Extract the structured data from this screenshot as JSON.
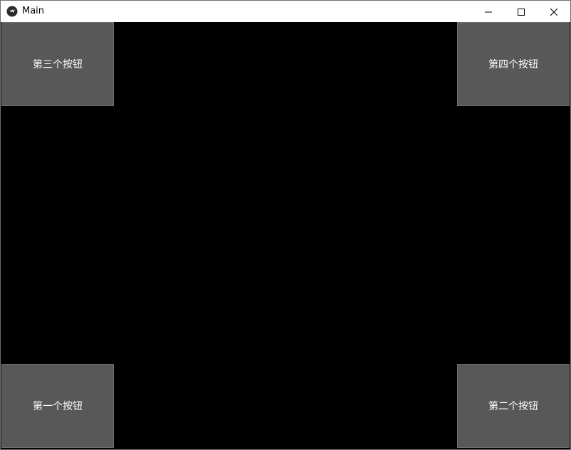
{
  "window": {
    "title": "Main",
    "icon": "kivy-logo-icon"
  },
  "controls": {
    "minimize": "minimize-icon",
    "maximize": "maximize-icon",
    "close": "close-icon"
  },
  "buttons": {
    "third": "第三个按钮",
    "fourth": "第四个按钮",
    "first": "第一个按钮",
    "second": "第二个按钮"
  },
  "colors": {
    "canvas": "#000000",
    "button": "#585858",
    "button_text": "#ffffff",
    "titlebar": "#ffffff"
  }
}
